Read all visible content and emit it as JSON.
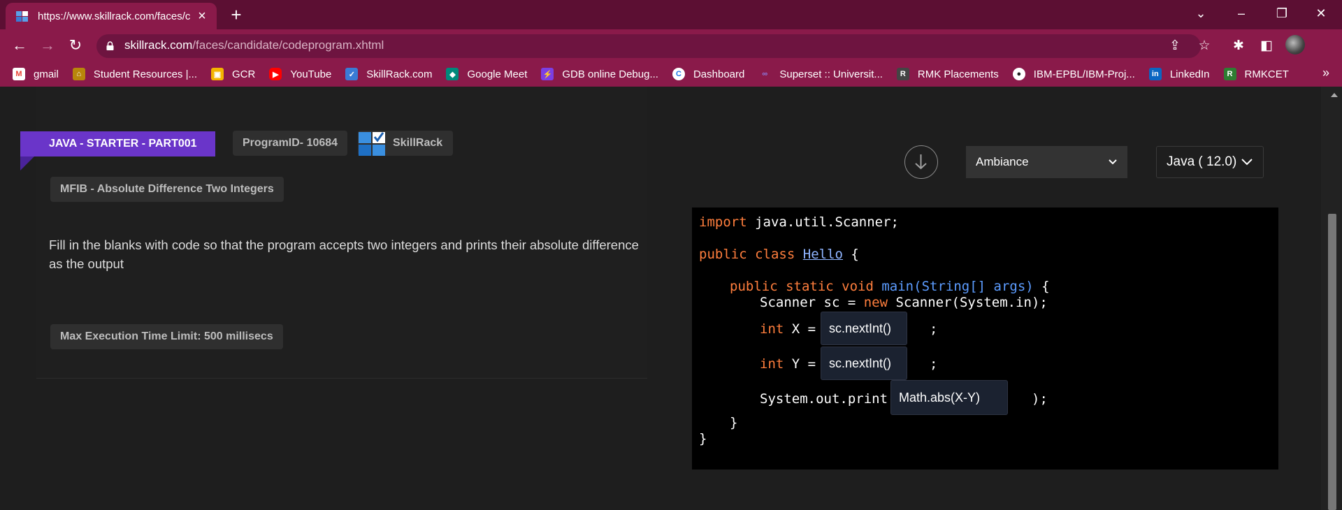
{
  "browser": {
    "tab_title": "https://www.skillrack.com/faces/c",
    "url_host": "skillrack.com",
    "url_path": "/faces/candidate/codeprogram.xhtml",
    "bookmarks": [
      {
        "label": "gmail",
        "icon": "gmail-icon",
        "color": "#ea4335"
      },
      {
        "label": "Student Resources |...",
        "icon": "building-icon",
        "color": "#b8860b"
      },
      {
        "label": "GCR",
        "icon": "classroom-icon",
        "color": "#f4b400"
      },
      {
        "label": "YouTube",
        "icon": "youtube-icon",
        "color": "#ff0000"
      },
      {
        "label": "SkillRack.com",
        "icon": "skillrack-icon",
        "color": "#3a7bd5"
      },
      {
        "label": "Google Meet",
        "icon": "meet-icon",
        "color": "#00897b"
      },
      {
        "label": "GDB online Debug...",
        "icon": "gdb-icon",
        "color": "#7b3fe4"
      },
      {
        "label": "Dashboard",
        "icon": "dashboard-icon",
        "color": "#1a73e8"
      },
      {
        "label": "Superset :: Universit...",
        "icon": "superset-icon",
        "color": "#5a3fb5"
      },
      {
        "label": "RMK Placements",
        "icon": "rmk-icon",
        "color": "#444444"
      },
      {
        "label": "IBM-EPBL/IBM-Proj...",
        "icon": "github-icon",
        "color": "#222222"
      },
      {
        "label": "LinkedIn",
        "icon": "linkedin-icon",
        "color": "#0a66c2"
      },
      {
        "label": "RMKCET",
        "icon": "rmkcet-icon",
        "color": "#2e7d32"
      }
    ]
  },
  "problem": {
    "category": "JAVA - STARTER - PART001",
    "program_id": "ProgramID- 10684",
    "brand": "SkillRack",
    "title": "MFIB - Absolute Difference Two Integers",
    "description": "Fill in the blanks with code so that the program accepts two integers and prints their absolute difference as the output",
    "time_limit": "Max Execution Time Limit: 500 millisecs"
  },
  "editor": {
    "theme": "Ambiance",
    "language": "Java ( 12.0)",
    "code": {
      "import_kw": "import",
      "import_rest": " java.util.Scanner;",
      "public_kw": "public",
      "class_kw": "class",
      "class_name": "Hello",
      "brace_open": " {",
      "method_mods": "public static void",
      "method_name": "main",
      "method_params": "(String[] args)",
      "scanner_line_a": "Scanner sc = ",
      "new_kw": "new",
      "scanner_line_b": " Scanner(System.in);",
      "int_kw": "int",
      "x_decl": " X = ",
      "y_decl": " Y = ",
      "semicolon": ";",
      "print_start": "System.out.print(",
      "print_end": ");",
      "inner_close": "}",
      "outer_close": "}"
    },
    "blanks": [
      "sc.nextInt()",
      "sc.nextInt()",
      "Math.abs(X-Y)"
    ]
  }
}
